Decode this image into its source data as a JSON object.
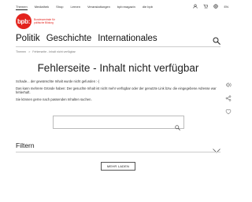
{
  "topnav": {
    "items": [
      "Themen",
      "Mediathek",
      "Shop",
      "Lernen",
      "Veranstaltungen",
      "bpb:magazin",
      "die bpb"
    ],
    "language": "EN"
  },
  "logo": {
    "mark": "bpb:",
    "subtitle": "Bundeszentrale für politische Bildung"
  },
  "mainnav": {
    "items": [
      "Politik",
      "Geschichte",
      "Internationales"
    ]
  },
  "breadcrumb": [
    "Themen",
    ">",
    "Fehlerseite - Inhalt nicht verfügbar"
  ],
  "page": {
    "title": "Fehlerseite - Inhalt nicht verfügbar",
    "paragraphs": [
      "Schade... der gewünschte Inhalt wurde nicht gefunden :-(",
      "Das kann mehrere Gründe haben: Der gesuchte Inhalt ist nicht mehr verfügbar oder der genutzte Link bzw. die eingegebene Adresse war fehlerhaft.",
      "Sie können gerne nach passenden Inhalten suchen."
    ]
  },
  "search": {
    "value": "",
    "placeholder": ""
  },
  "filter": {
    "label": "Filtern"
  },
  "more_button": {
    "label": "MEHR LADEN"
  },
  "colors": {
    "brand": "#e3231d",
    "text": "#222222",
    "divider": "#cccccc"
  },
  "icons": [
    "user-icon",
    "cart-icon",
    "globe-icon",
    "search-icon",
    "chevron-down-icon",
    "listen-icon",
    "share-icon",
    "bookmark-icon"
  ]
}
